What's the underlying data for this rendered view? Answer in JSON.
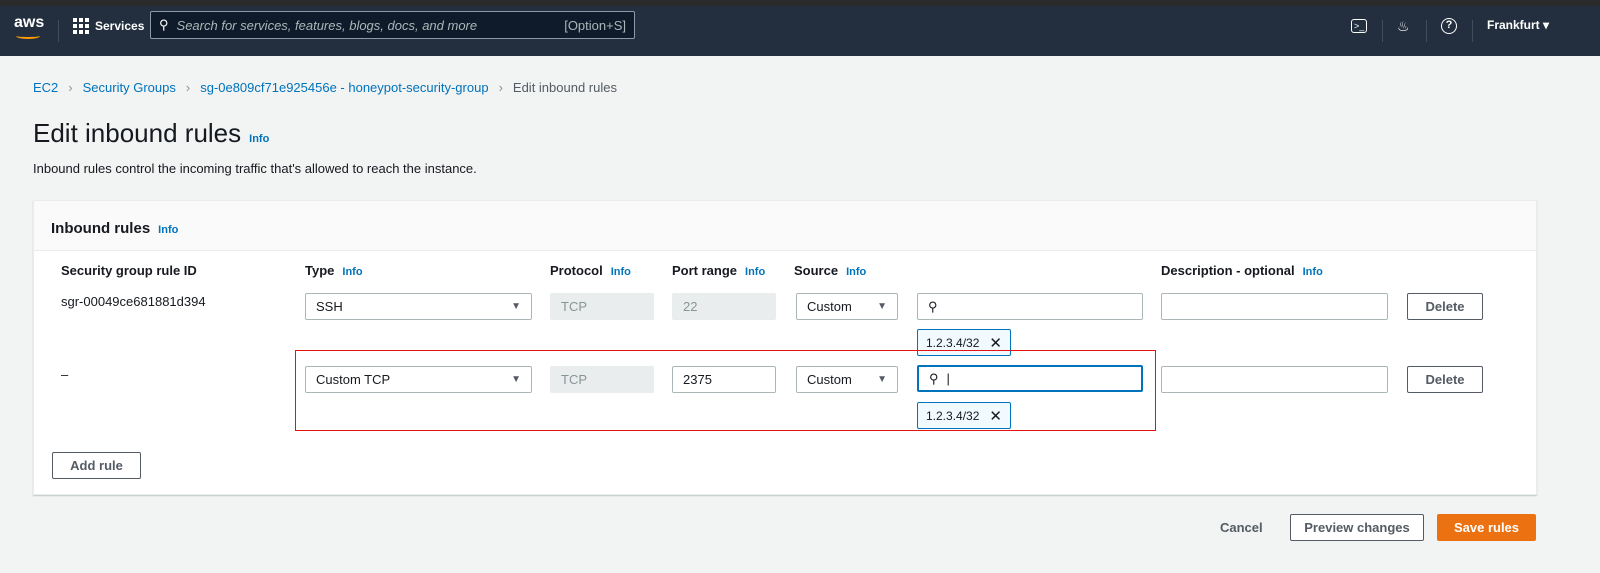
{
  "nav": {
    "logo": "aws",
    "services": "Services",
    "search_placeholder": "Search for services, features, blogs, docs, and more",
    "search_shortcut": "[Option+S]",
    "region": "Frankfurt"
  },
  "breadcrumb": [
    "EC2",
    "Security Groups",
    "sg-0e809cf71e925456e - honeypot-security-group",
    "Edit inbound rules"
  ],
  "page": {
    "title": "Edit inbound rules",
    "info": "Info",
    "description": "Inbound rules control the incoming traffic that's allowed to reach the instance."
  },
  "panel": {
    "title": "Inbound rules",
    "info": "Info",
    "columns": {
      "rule_id": "Security group rule ID",
      "type": "Type",
      "protocol": "Protocol",
      "port": "Port range",
      "source": "Source",
      "description": "Description - optional",
      "info": "Info"
    },
    "rows": [
      {
        "rule_id": "sgr-00049ce681881d394",
        "type": "SSH",
        "protocol": "TCP",
        "port": "22",
        "source": "Custom",
        "search": "",
        "tag": "1.2.3.4/32",
        "description": "",
        "delete": "Delete"
      },
      {
        "rule_id": "–",
        "type": "Custom TCP",
        "protocol": "TCP",
        "port": "2375",
        "source": "Custom",
        "search": "",
        "tag": "1.2.3.4/32",
        "description": "",
        "delete": "Delete"
      }
    ],
    "add_rule": "Add rule"
  },
  "footer": {
    "cancel": "Cancel",
    "preview": "Preview changes",
    "save": "Save rules"
  }
}
